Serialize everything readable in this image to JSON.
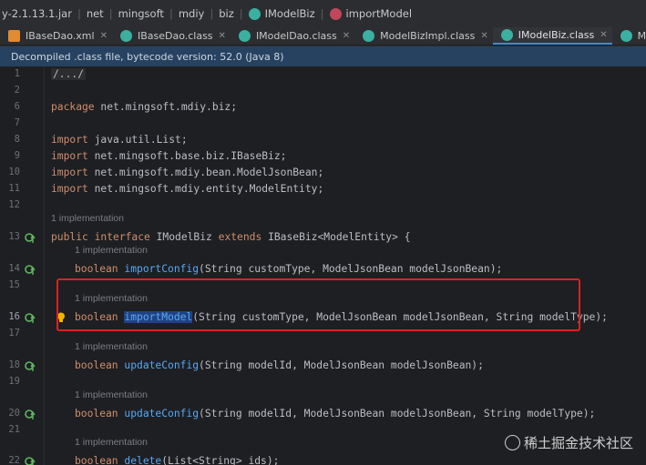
{
  "breadcrumb": {
    "items": [
      "y-2.1.13.1.jar",
      "net",
      "mingsoft",
      "mdiy",
      "biz",
      "IModelBiz",
      "importModel"
    ]
  },
  "tabs": [
    {
      "label": "IBaseDao.xml",
      "type": "xml",
      "active": false
    },
    {
      "label": "IBaseDao.class",
      "type": "class",
      "active": false
    },
    {
      "label": "IModelDao.class",
      "type": "class",
      "active": false
    },
    {
      "label": "ModelBizImpl.class",
      "type": "class",
      "active": false
    },
    {
      "label": "IModelBiz.class",
      "type": "class",
      "active": true
    },
    {
      "label": "ModelAction.class",
      "type": "class",
      "active": false
    }
  ],
  "notice": "Decompiled .class file, bytecode version: 52.0 (Java 8)",
  "editor": {
    "lines": [
      {
        "num": "1",
        "text": "/.../"
      },
      {
        "num": "6",
        "kw": "package",
        "rest": " net.mingsoft.mdiy.biz;"
      },
      {
        "num": "8",
        "kw": "import",
        "rest": " java.util.List;"
      },
      {
        "num": "9",
        "kw": "import",
        "rest": " net.mingsoft.base.biz.IBaseBiz;"
      },
      {
        "num": "10",
        "kw": "import",
        "rest": " net.mingsoft.mdiy.bean.ModelJsonBean;"
      },
      {
        "num": "11",
        "kw": "import",
        "rest": " net.mingsoft.mdiy.entity.ModelEntity;"
      },
      {
        "num": "13",
        "kw": "public interface",
        "rest": " IModelBiz ",
        "kw2": "extends",
        "rest2": " IBaseBiz<ModelEntity> {"
      },
      {
        "num": "14",
        "kw": "boolean",
        "fn": "importConfig",
        "rest": "(String customType, ModelJsonBean modelJsonBean);"
      },
      {
        "num": "16",
        "kw": "boolean",
        "fn": "importModel",
        "rest": "(String customType, ModelJsonBean modelJsonBean, String modelType);"
      },
      {
        "num": "17"
      },
      {
        "num": "18",
        "kw": "boolean",
        "fn": "updateConfig",
        "rest": "(String modelId, ModelJsonBean modelJsonBean);"
      },
      {
        "num": "19"
      },
      {
        "num": "20",
        "kw": "boolean",
        "fn": "updateConfig",
        "rest": "(String modelId, ModelJsonBean modelJsonBean, String modelType);"
      },
      {
        "num": "21"
      },
      {
        "num": "22",
        "kw": "boolean",
        "fn": "delete",
        "rest": "(List<String> ids);"
      }
    ],
    "line_nums_blank": [
      "2",
      "7",
      "12",
      "15"
    ],
    "hint": "1 implementation"
  },
  "watermark": "稀土掘金技术社区",
  "colors": {
    "highlight_box": "#e02020",
    "keyword": "#cf8e6d",
    "function": "#56a8f5"
  }
}
